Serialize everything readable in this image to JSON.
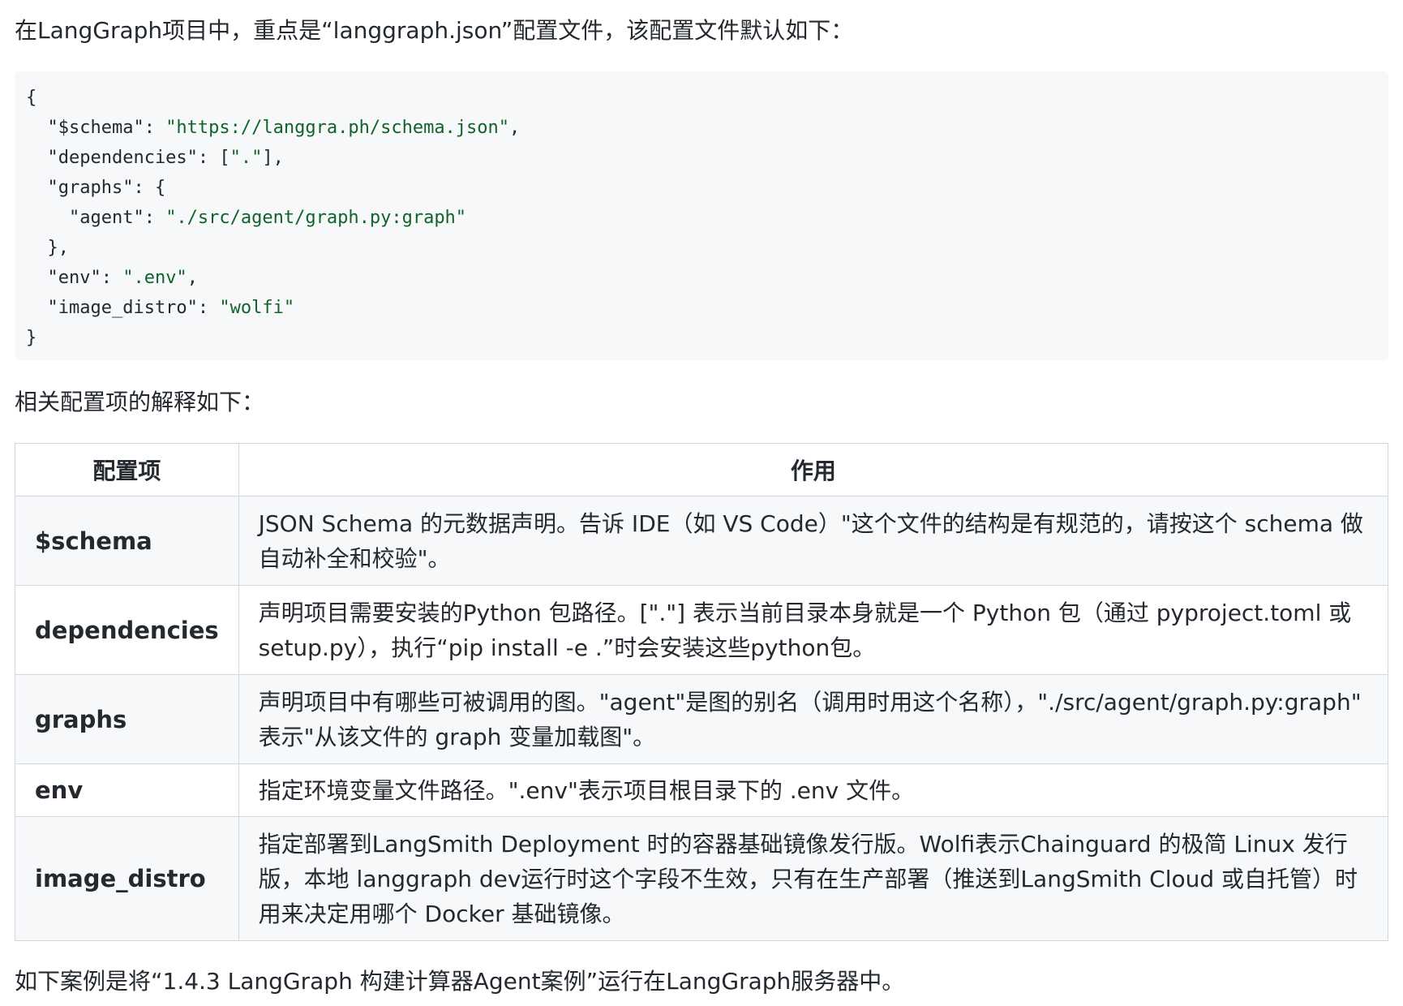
{
  "intro": "在LangGraph项目中，重点是“langgraph.json”配置文件，该配置文件默认如下：",
  "code": {
    "lines": [
      [
        {
          "t": "{",
          "c": "key"
        }
      ],
      [
        {
          "t": "  \"$schema\": ",
          "c": "key"
        },
        {
          "t": "\"https://langgra.ph/schema.json\"",
          "c": "str"
        },
        {
          "t": ",",
          "c": "key"
        }
      ],
      [
        {
          "t": "  \"dependencies\": [",
          "c": "key"
        },
        {
          "t": "\".\"",
          "c": "str"
        },
        {
          "t": "],",
          "c": "key"
        }
      ],
      [
        {
          "t": "  \"graphs\": {",
          "c": "key"
        }
      ],
      [
        {
          "t": "    \"agent\": ",
          "c": "key"
        },
        {
          "t": "\"./src/agent/graph.py:graph\"",
          "c": "str"
        }
      ],
      [
        {
          "t": "  },",
          "c": "key"
        }
      ],
      [
        {
          "t": "  \"env\": ",
          "c": "key"
        },
        {
          "t": "\".env\"",
          "c": "str"
        },
        {
          "t": ",",
          "c": "key"
        }
      ],
      [
        {
          "t": "  \"image_distro\": ",
          "c": "key"
        },
        {
          "t": "\"wolfi\"",
          "c": "str"
        }
      ],
      [
        {
          "t": "}",
          "c": "key"
        }
      ]
    ]
  },
  "explain_heading": "相关配置项的解释如下：",
  "table": {
    "headers": [
      "配置项",
      "作用"
    ],
    "rows": [
      {
        "name": "$schema",
        "desc": "JSON Schema 的元数据声明。告诉 IDE（如 VS Code）\"这个文件的结构是有规范的，请按这个 schema 做自动补全和校验\"。"
      },
      {
        "name": "dependencies",
        "desc": "声明项目需要安装的Python 包路径。[\".\"] 表示当前目录本身就是一个 Python 包（通过 pyproject.toml 或 setup.py），执行“pip install -e .”时会安装这些python包。"
      },
      {
        "name": "graphs",
        "desc": "声明项目中有哪些可被调用的图。\"agent\"是图的别名（调用时用这个名称），\"./src/agent/graph.py:graph\" 表示\"从该文件的 graph 变量加载图\"。"
      },
      {
        "name": "env",
        "desc": "指定环境变量文件路径。\".env\"表示项目根目录下的 .env 文件。"
      },
      {
        "name": "image_distro",
        "desc": "指定部署到LangSmith Deployment 时的容器基础镜像发行版。Wolfi表示Chainguard 的极简 Linux 发行版，本地 langgraph dev运行时这个字段不生效，只有在生产部署（推送到LangSmith Cloud 或自托管）时用来决定用哪个 Docker 基础镜像。"
      }
    ]
  },
  "outro": "如下案例是将“1.4.3 LangGraph 构建计算器Agent案例”运行在LangGraph服务器中。"
}
